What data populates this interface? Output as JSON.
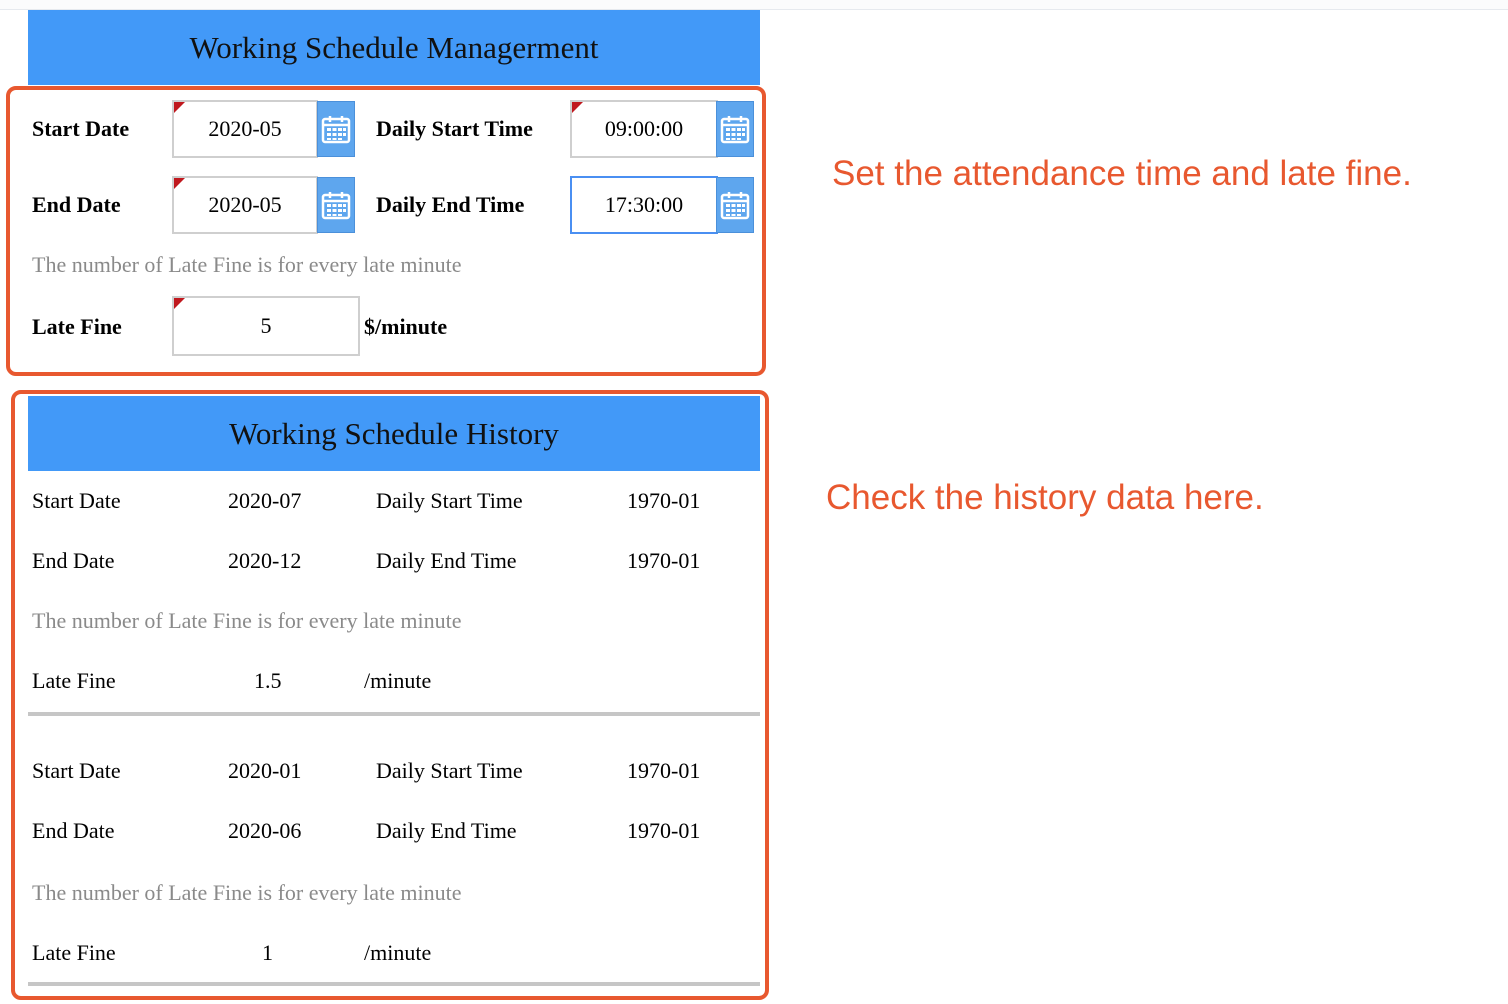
{
  "management": {
    "title": "Working Schedule Managerment",
    "start_date_label": "Start Date",
    "start_date_value": "2020-05",
    "daily_start_label": "Daily Start Time",
    "daily_start_value": "09:00:00",
    "end_date_label": "End Date",
    "end_date_value": "2020-05",
    "daily_end_label": "Daily End Time",
    "daily_end_value": "17:30:00",
    "note": "The number of Late Fine is for every late minute",
    "late_fine_label": "Late Fine",
    "late_fine_value": "5",
    "late_fine_unit": "$/minute"
  },
  "history": {
    "title": "Working Schedule History",
    "records": [
      {
        "start_date_label": "Start Date",
        "start_date": "2020-07",
        "daily_start_label": "Daily Start Time",
        "daily_start": "1970-01",
        "end_date_label": "End Date",
        "end_date": "2020-12",
        "daily_end_label": "Daily End Time",
        "daily_end": "1970-01",
        "note": "The number of Late Fine is for every late minute",
        "late_fine_label": "Late Fine",
        "late_fine": "1.5",
        "unit": "/minute"
      },
      {
        "start_date_label": "Start Date",
        "start_date": "2020-01",
        "daily_start_label": "Daily Start Time",
        "daily_start": "1970-01",
        "end_date_label": "End Date",
        "end_date": "2020-06",
        "daily_end_label": "Daily End Time",
        "daily_end": "1970-01",
        "note": "The number of Late Fine is for every late minute",
        "late_fine_label": "Late Fine",
        "late_fine": "1",
        "unit": "/minute"
      }
    ]
  },
  "callouts": {
    "top": "Set the attendance time and late fine.",
    "bottom": "Check the history data here."
  },
  "colors": {
    "header_blue": "#4299f8",
    "highlight_orange": "#e8582f",
    "calendar_button": "#5ea6ee",
    "required_flag": "#c0181e"
  },
  "icons": [
    "calendar-icon",
    "required-flag-icon"
  ]
}
